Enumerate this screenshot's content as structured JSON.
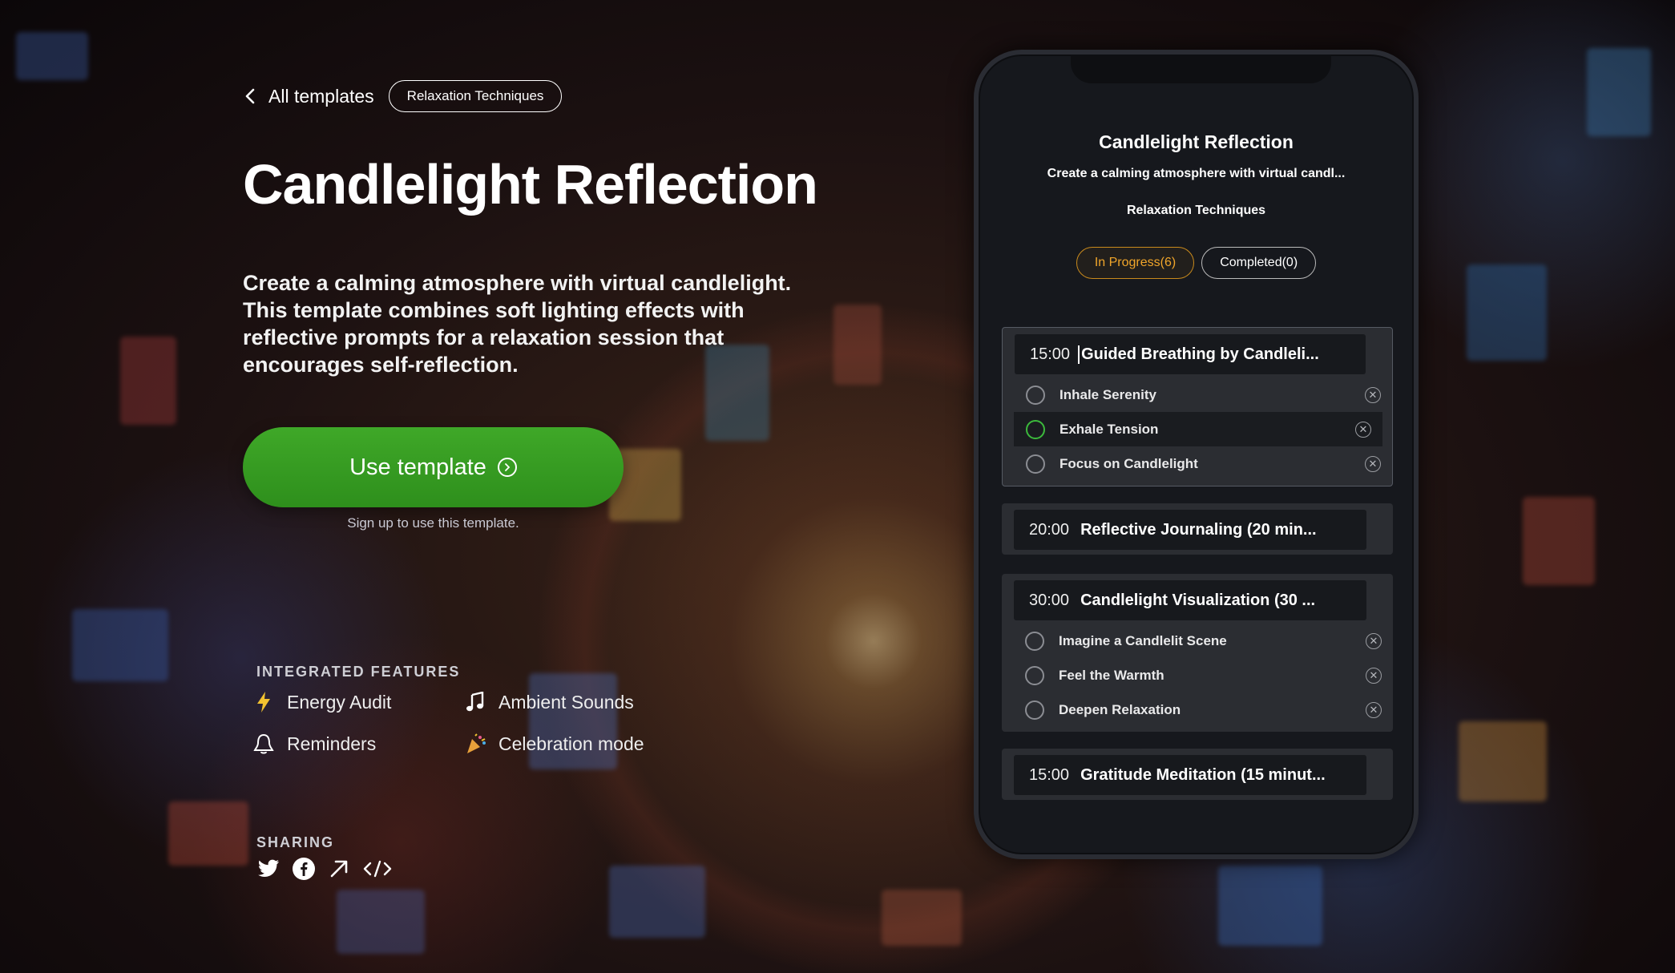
{
  "nav": {
    "back_label": "All templates",
    "category_tag": "Relaxation Techniques"
  },
  "hero": {
    "title": "Candlelight Reflection",
    "description": "Create a calming atmosphere with virtual candlelight. This template combines soft lighting effects with reflective prompts for a relaxation session that encourages self-reflection.",
    "cta_label": "Use template",
    "signup_note": "Sign up to use this template."
  },
  "features": {
    "heading": "INTEGRATED FEATURES",
    "items": [
      {
        "label": "Energy Audit",
        "icon": "lightning-icon"
      },
      {
        "label": "Ambient Sounds",
        "icon": "music-note-icon"
      },
      {
        "label": "Reminders",
        "icon": "bell-icon"
      },
      {
        "label": "Celebration mode",
        "icon": "party-icon"
      }
    ]
  },
  "sharing": {
    "heading": "SHARING",
    "icons": [
      "twitter-icon",
      "facebook-icon",
      "share-arrow-icon",
      "embed-code-icon"
    ]
  },
  "phone": {
    "title": "Candlelight Reflection",
    "subtitle": "Create a calming atmosphere with virtual candl...",
    "category": "Relaxation Techniques",
    "tabs": [
      {
        "label": "In Progress(6)",
        "active": true
      },
      {
        "label": "Completed(0)",
        "active": false
      }
    ],
    "groups": [
      {
        "time": "15:00",
        "name": "Guided Breathing by Candleli...",
        "items": [
          {
            "label": "Inhale Serenity"
          },
          {
            "label": "Exhale Tension"
          },
          {
            "label": "Focus on Candlelight"
          }
        ]
      },
      {
        "time": "20:00",
        "name": "Reflective Journaling (20 min...",
        "items": []
      },
      {
        "time": "30:00",
        "name": "Candlelight Visualization (30 ...",
        "items": [
          {
            "label": "Imagine a Candlelit Scene"
          },
          {
            "label": "Feel the Warmth"
          },
          {
            "label": "Deepen Relaxation"
          }
        ]
      },
      {
        "time": "15:00",
        "name": "Gratitude Meditation (15 minut...",
        "items": []
      }
    ]
  },
  "colors": {
    "cta_green": "#2e8f1c",
    "active_tab": "#f0a52a",
    "checked_ring": "#3cba3c"
  }
}
